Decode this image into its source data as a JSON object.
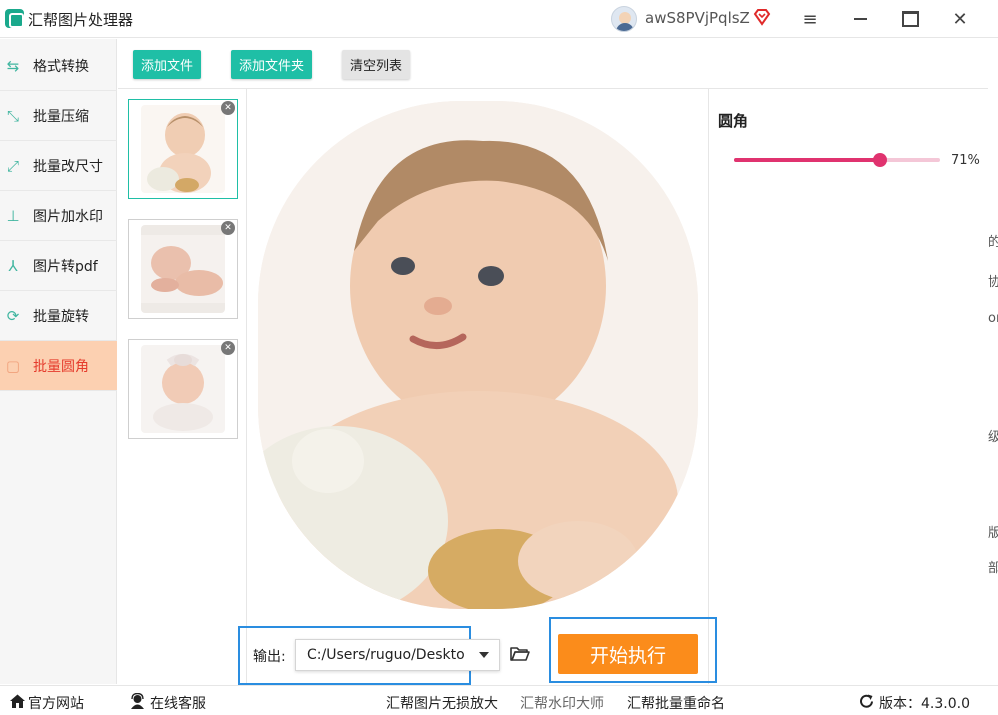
{
  "app": {
    "title": "汇帮图片处理器"
  },
  "user": {
    "name": "awS8PVjPqlsZ"
  },
  "colors": {
    "accent_teal": "#1fbfa6",
    "active_nav_bg": "#fcd0b1",
    "active_nav_text": "#e53b2c",
    "slider": "#e0336f",
    "start_button": "#fb8c1b",
    "highlight_box": "#2a8de0"
  },
  "sidebar": {
    "items": [
      {
        "label": "格式转换",
        "icon": "format-convert-icon",
        "active": false
      },
      {
        "label": "批量压缩",
        "icon": "compress-icon",
        "active": false
      },
      {
        "label": "批量改尺寸",
        "icon": "resize-icon",
        "active": false
      },
      {
        "label": "图片加水印",
        "icon": "watermark-icon",
        "active": false
      },
      {
        "label": "图片转pdf",
        "icon": "pdf-icon",
        "active": false
      },
      {
        "label": "批量旋转",
        "icon": "rotate-icon",
        "active": false
      },
      {
        "label": "批量圆角",
        "icon": "round-corner-icon",
        "active": true
      }
    ]
  },
  "toolbar": {
    "add_file": "添加文件",
    "add_folder": "添加文件夹",
    "clear_list": "清空列表"
  },
  "thumbnails": [
    {
      "selected": true
    },
    {
      "selected": false
    },
    {
      "selected": false
    }
  ],
  "settings": {
    "title": "圆角",
    "slider_value": 71,
    "slider_value_label": "71%"
  },
  "output": {
    "label": "输出:",
    "path": "C:/Users/ruguo/Desktop"
  },
  "actions": {
    "start": "开始执行"
  },
  "footer": {
    "official_site": "官方网站",
    "online_service": "在线客服",
    "link1": "汇帮图片无损放大",
    "link2": "汇帮水印大师",
    "link3": "汇帮批量重命名",
    "version": "版本：4.3.0.0"
  },
  "edge_text": [
    "的生",
    "协作",
    "or",
    "级",
    "版",
    "部"
  ]
}
